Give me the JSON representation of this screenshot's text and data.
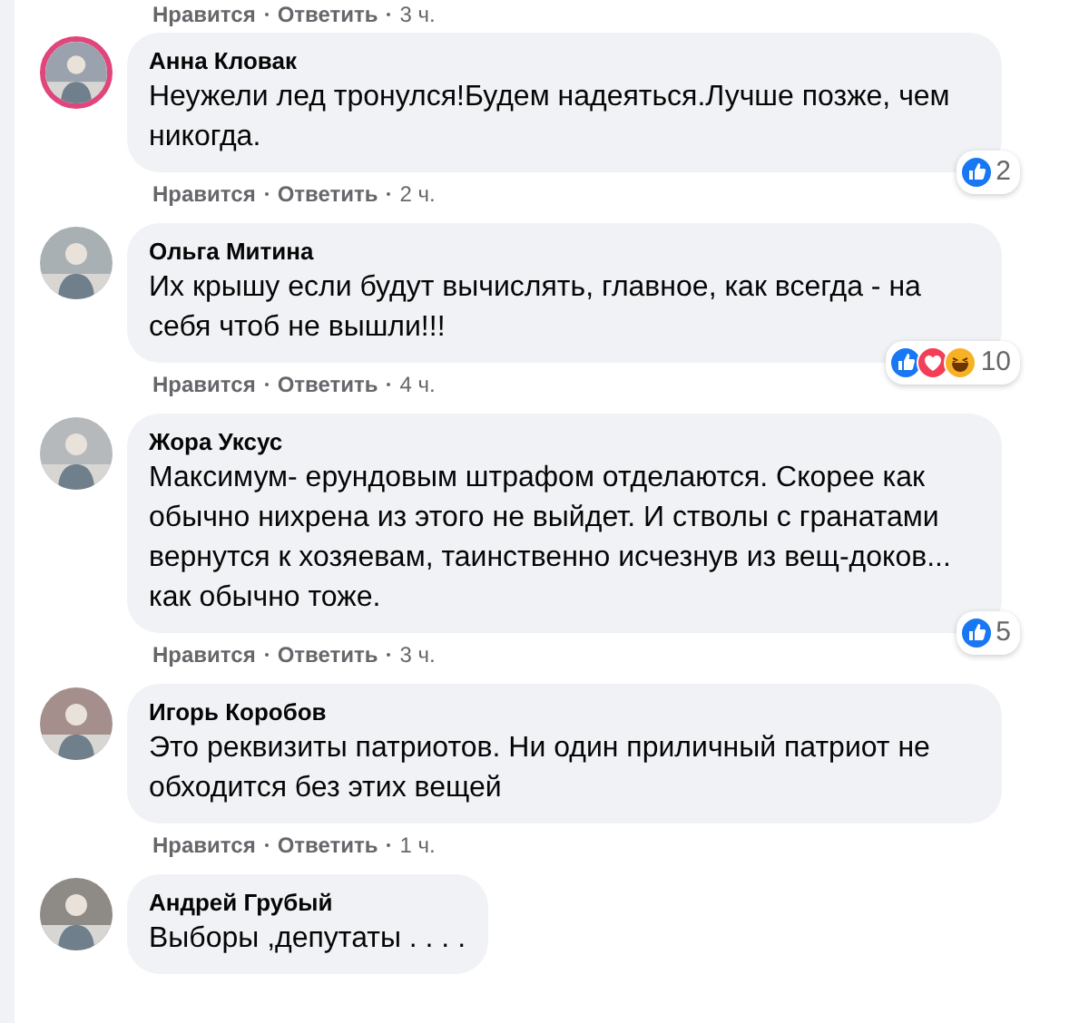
{
  "top_meta": {
    "like": "Нравится",
    "reply": "Ответить",
    "time": "3 ч."
  },
  "comments": [
    {
      "author": "Анна Кловак",
      "text": "Неужели лед тронулся!Будем надеяться.Лучше позже, чем никогда.",
      "avatar_ring": true,
      "reactions": [
        {
          "kind": "like"
        }
      ],
      "reaction_count": "2",
      "like": "Нравится",
      "reply": "Ответить",
      "time": "2 ч."
    },
    {
      "author": "Ольга Митина",
      "text": "Их крышу если будут вычислять, главное, как всегда - на себя чтоб не вышли!!!",
      "avatar_ring": false,
      "reactions": [
        {
          "kind": "like"
        },
        {
          "kind": "love"
        },
        {
          "kind": "haha"
        }
      ],
      "reaction_count": "10",
      "like": "Нравится",
      "reply": "Ответить",
      "time": "4 ч."
    },
    {
      "author": "Жора Уксус",
      "text": "Максимум- ерундовым штрафом отделаются. Скорее как обычно нихрена из этого не выйдет. И стволы с гранатами вернутся к хозяевам, таинственно исчезнув из вещ-доков... как обычно тоже.",
      "avatar_ring": false,
      "reactions": [
        {
          "kind": "like"
        }
      ],
      "reaction_count": "5",
      "like": "Нравится",
      "reply": "Ответить",
      "time": "3 ч."
    },
    {
      "author": "Игорь Коробов",
      "text": "Это реквизиты патриотов. Ни один приличный патриот не обходится без этих вещей",
      "avatar_ring": false,
      "like": "Нравится",
      "reply": "Ответить",
      "time": "1 ч."
    },
    {
      "author": "Андрей Грубый",
      "text": "Выборы ,депутаты . . . .",
      "avatar_ring": false
    }
  ]
}
